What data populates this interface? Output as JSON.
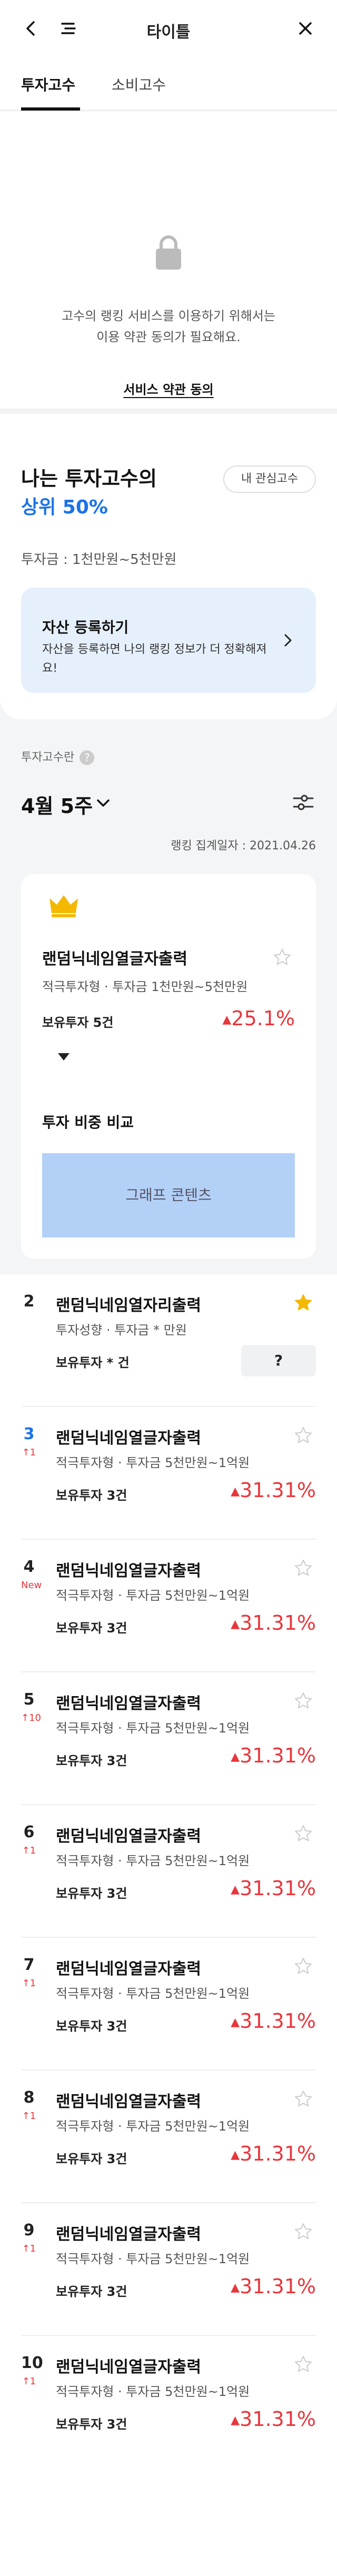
{
  "header": {
    "title": "타이틀",
    "back_icon": "back-arrow-icon",
    "menu_icon": "menu-icon",
    "close_icon": "close-icon"
  },
  "tabs": [
    {
      "label": "투자고수",
      "active": true
    },
    {
      "label": "소비고수",
      "active": false
    }
  ],
  "lock": {
    "message_line1": "고수의 랭킹 서비스를 이용하기 위해서는",
    "message_line2": "이용 약관 동의가 필요해요.",
    "consent_label": "서비스 약관 동의"
  },
  "profile": {
    "heading": "나는 투자고수의",
    "rank": "상위 50%",
    "watch_button": "내 관심고수",
    "amount": "투자금 : 1천만원~5천만원",
    "asset_card": {
      "title": "자산 등록하기",
      "desc": "자산을 등록하면 나의 랭킹 정보가 더 정확해져요!"
    }
  },
  "ranking": {
    "section_label": "투자고수란",
    "week": "4월 5주",
    "date": "랭킹 집계일자 : 2021.04.26"
  },
  "top": {
    "name": "랜덤닉네임열글자출력",
    "sub": "적극투자형 · 투자금 1천만원~5천만원",
    "hold": "보유투자 5건",
    "pct": "25.1%",
    "compare_title": "투자 비중 비교",
    "graph_placeholder": "그래프 콘텐츠"
  },
  "rows": [
    {
      "num": "2",
      "delta": "",
      "name": "랜덤닉네임열자리출력",
      "sub": "투자성향 · 투자금 * 만원",
      "hold": "보유투자 * 건",
      "pct": "",
      "q": "?",
      "starred": true
    },
    {
      "num": "3",
      "delta": "↑1",
      "name": "랜덤닉네임열글자출력",
      "sub": "적극투자형 · 투자금 5천만원~1억원",
      "hold": "보유투자 3건",
      "pct": "31.31%",
      "q": "",
      "starred": false
    },
    {
      "num": "4",
      "delta": "New",
      "name": "랜덤닉네임열글자출력",
      "sub": "적극투자형 · 투자금 5천만원~1억원",
      "hold": "보유투자 3건",
      "pct": "31.31%",
      "q": "",
      "starred": false
    },
    {
      "num": "5",
      "delta": "↑10",
      "name": "랜덤닉네임열글자출력",
      "sub": "적극투자형 · 투자금 5천만원~1억원",
      "hold": "보유투자 3건",
      "pct": "31.31%",
      "q": "",
      "starred": false
    },
    {
      "num": "6",
      "delta": "↑1",
      "name": "랜덤닉네임열글자출력",
      "sub": "적극투자형 · 투자금 5천만원~1억원",
      "hold": "보유투자 3건",
      "pct": "31.31%",
      "q": "",
      "starred": false
    },
    {
      "num": "7",
      "delta": "↑1",
      "name": "랜덤닉네임열글자출력",
      "sub": "적극투자형 · 투자금 5천만원~1억원",
      "hold": "보유투자 3건",
      "pct": "31.31%",
      "q": "",
      "starred": false
    },
    {
      "num": "8",
      "delta": "↑1",
      "name": "랜덤닉네임열글자출력",
      "sub": "적극투자형 · 투자금 5천만원~1억원",
      "hold": "보유투자 3건",
      "pct": "31.31%",
      "q": "",
      "starred": false
    },
    {
      "num": "9",
      "delta": "↑1",
      "name": "랜덤닉네임열글자출력",
      "sub": "적극투자형 · 투자금 5천만원~1억원",
      "hold": "보유투자 3건",
      "pct": "31.31%",
      "q": "",
      "starred": false
    },
    {
      "num": "10",
      "delta": "↑1",
      "name": "랜덤닉네임열글자출력",
      "sub": "적극투자형 · 투자금 5천만원~1억원",
      "hold": "보유투자 3건",
      "pct": "31.31%",
      "q": "",
      "starred": false
    }
  ],
  "colors": {
    "accent_blue": "#1a73e8",
    "up_red": "#e8363c",
    "star_gold": "#f5b800",
    "card_blue": "#e6f0fc"
  }
}
